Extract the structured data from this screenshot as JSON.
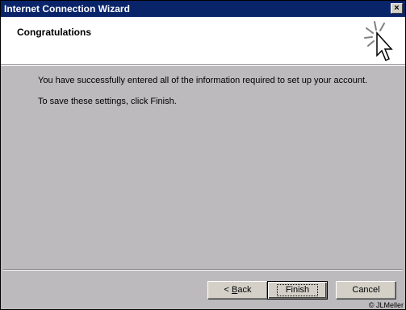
{
  "window": {
    "title": "Internet Connection Wizard",
    "close_label": "×"
  },
  "header": {
    "title": "Congratulations",
    "icon": "wizard-sparkle-cursor-icon"
  },
  "content": {
    "line1": "You have successfully entered all of the information required to set up your account.",
    "line2": "To save these settings, click Finish."
  },
  "buttons": {
    "back_prefix": "< ",
    "back_accel": "B",
    "back_rest": "ack",
    "finish": "Finish",
    "cancel": "Cancel"
  },
  "footer": {
    "copyright": "© JLMeller"
  },
  "colors": {
    "titlebar": "#0a246a",
    "face": "#bdbabd",
    "button": "#d4d0c8"
  }
}
